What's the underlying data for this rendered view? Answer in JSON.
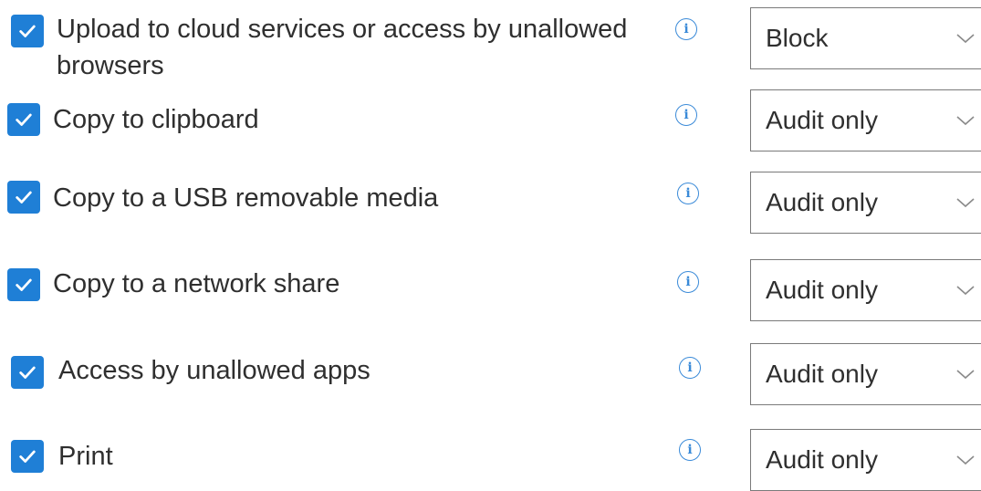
{
  "rows": [
    {
      "label": "Upload to cloud services or access by unallowed",
      "label_line2": "browsers",
      "checked": true,
      "info_icon": "info-icon",
      "action": "Block"
    },
    {
      "label": "Copy to clipboard",
      "checked": true,
      "info_icon": "info-icon",
      "action": "Audit only"
    },
    {
      "label": "Copy to a USB removable media",
      "checked": true,
      "info_icon": "info-icon",
      "action": "Audit only"
    },
    {
      "label": "Copy to a network share",
      "checked": true,
      "info_icon": "info-icon",
      "action": "Audit only"
    },
    {
      "label": "Access by unallowed apps",
      "checked": true,
      "info_icon": "info-icon",
      "action": "Audit only"
    },
    {
      "label": "Print",
      "checked": true,
      "info_icon": "info-icon",
      "action": "Audit only"
    }
  ],
  "colors": {
    "checkbox": "#1f7fd6",
    "info": "#3a8ad8",
    "text": "#2f2f2f",
    "select_border": "#7a7a7a"
  },
  "icons": {
    "check": "check-icon",
    "info": "info-icon",
    "chevron": "chevron-down-icon"
  }
}
